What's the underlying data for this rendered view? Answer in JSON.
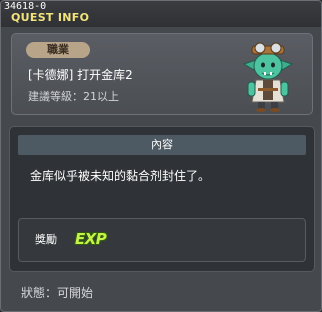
{
  "window": {
    "quest_id": "34618-0",
    "title": "QUEST INFO"
  },
  "quest": {
    "job_label": "職業",
    "name": "[卡德娜] 打开金库2",
    "level_text": "建議等級：21以上",
    "npc_icon": "npc-goblin-portrait"
  },
  "content": {
    "header": "內容",
    "description": "金库似乎被未知的黏合剂封住了。"
  },
  "reward": {
    "label": "獎勵",
    "icon": "exp-icon",
    "icon_text": "EXP"
  },
  "status": {
    "text": "狀態：可開始"
  },
  "colors": {
    "title": "#f3e47a",
    "job_badge": "#b8a488",
    "exp": "#c6f24a",
    "panel": "#45484d"
  }
}
